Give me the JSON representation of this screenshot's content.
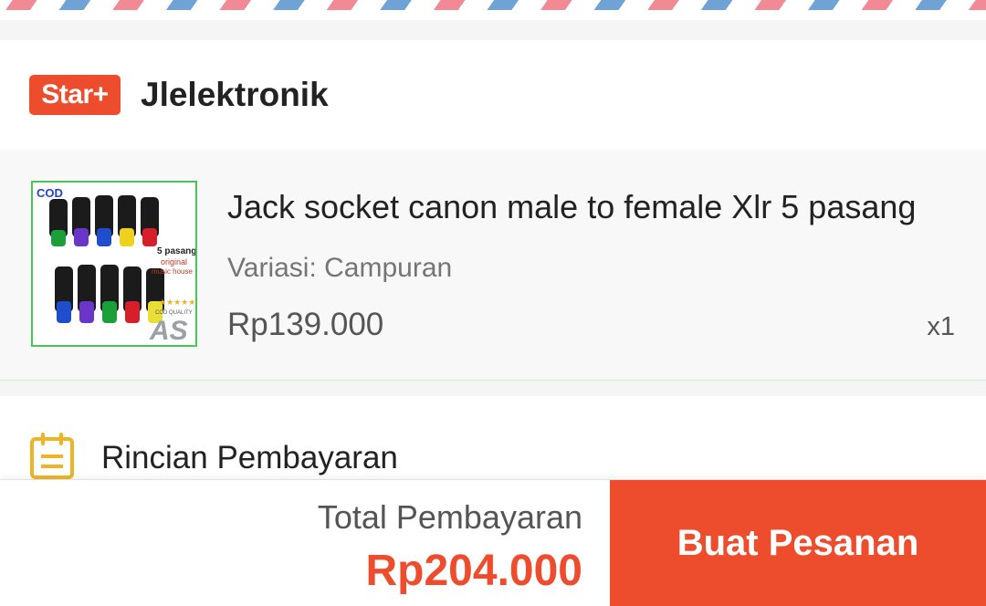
{
  "shop": {
    "badge": "Star+",
    "name": "Jlelektronik"
  },
  "product": {
    "title": "Jack socket canon male to female Xlr 5 pasang",
    "variation": "Variasi: Campuran",
    "price": "Rp139.000",
    "quantity": "x1",
    "image_text": {
      "cod": "COD",
      "pack": "5 pasang",
      "line1": "original",
      "line2": "music house",
      "quality": "COD QUALITY",
      "mark": "AS"
    }
  },
  "payment": {
    "icon": "document-list-icon",
    "title": "Rincian Pembayaran"
  },
  "footer": {
    "total_label": "Total Pembayaran",
    "total_value": "Rp204.000",
    "order_button": "Buat Pesanan"
  },
  "colors": {
    "accent": "#ee4d2d",
    "icon_yellow": "#f0b324",
    "thumb_border": "#48c45a"
  }
}
